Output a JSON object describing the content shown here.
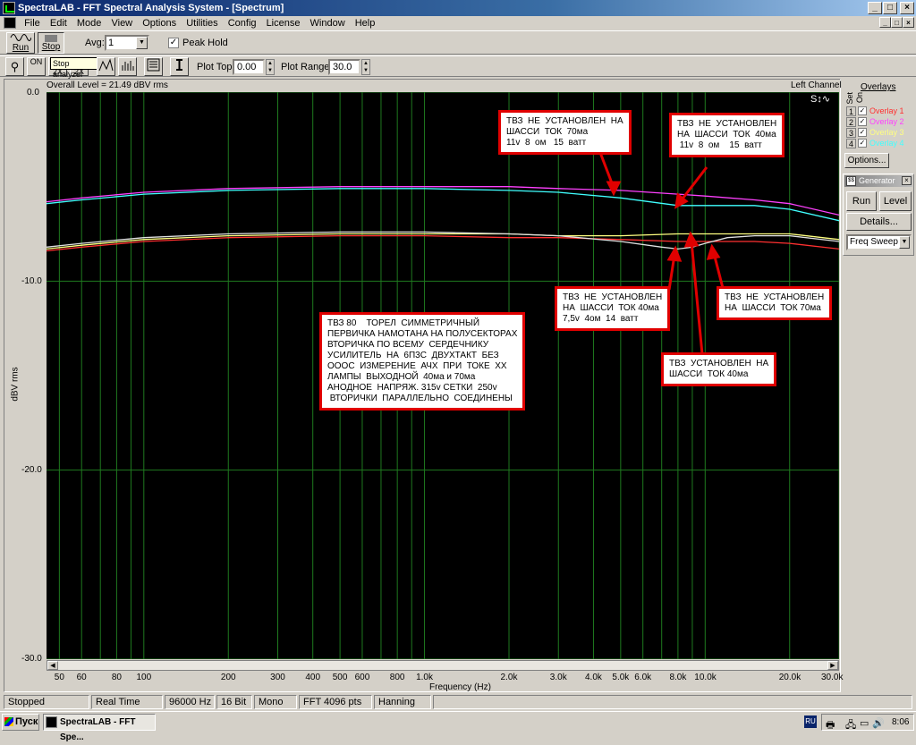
{
  "window": {
    "title": "SpectraLAB - FFT Spectral Analysis System - [Spectrum]"
  },
  "menu": [
    "File",
    "Edit",
    "Mode",
    "View",
    "Options",
    "Utilities",
    "Config",
    "License",
    "Window",
    "Help"
  ],
  "toolbar": {
    "run_label": "Run",
    "stop_label": "Stop",
    "avg_label": "Avg:",
    "avg_value": "1",
    "peak_hold_label": "Peak Hold",
    "peak_hold_checked": true,
    "tooltip": "Stop analyzer",
    "zoom_labels": [
      "ON",
      "2X",
      "2X"
    ],
    "plot_top_label": "Plot Top:",
    "plot_top_value": "0.00",
    "plot_range_label": "Plot Range:",
    "plot_range_value": "30.0"
  },
  "plot": {
    "overall_level": "Overall Level = 21.49 dBV rms",
    "channel": "Left Channel",
    "y_axis_label": "dBV rms",
    "x_axis_label": "Frequency (Hz)",
    "y_ticks": [
      "0.0",
      "-10.0",
      "-20.0",
      "-30.0"
    ],
    "x_ticks": [
      "50",
      "60",
      "80",
      "100",
      "200",
      "300",
      "400",
      "500",
      "600",
      "800",
      "1.0k",
      "2.0k",
      "3.0k",
      "4.0k",
      "5.0k",
      "6.0k",
      "8.0k",
      "10.0k",
      "20.0k",
      "30.0k"
    ]
  },
  "annotations": {
    "a1": "ТВЗ  НЕ  УСТАНОВЛЕН  НА\nШАССИ  ТОК  70ма\n11v  8  ом   15  ватт",
    "a2": "ТВЗ  НЕ  УСТАНОВЛЕН\nНА  ШАССИ  ТОК  40ма\n 11v  8  ом    15  ватт",
    "a3": "ТВЗ  НЕ  УСТАНОВЛЕН\nНА  ШАССИ  ТОК 40ма\n7,5v  4ом  14  ватт",
    "a4": "ТВЗ  НЕ  УСТАНОВЛЕН\nНА  ШАССИ  ТОК 70ма",
    "a5": "ТВЗ  УСТАНОВЛЕН  НА\nШАССИ  ТОК 40ма",
    "a6": "ТВЗ 80    ТОРЕЛ  СИММЕТРИЧНЫЙ\nПЕРВИЧКА НАМОТАНА НА ПОЛУСЕКТОРАХ\nВТОРИЧКА ПО ВСЕМУ  СЕРДЕЧНИКУ\nУСИЛИТЕЛЬ  НА  6П3С  ДВУХТАКТ  БЕЗ\nОООС  ИЗМЕРЕНИЕ  АЧХ  ПРИ  ТОКЕ  ХХ\nЛАМПЫ  ВЫХОДНОЙ  40ма и 70ма\nАНОДНОЕ  НАПРЯЖ. 315v СЕТКИ  250v\n ВТОРИЧКИ  ПАРАЛЛЕЛЬНО  СОЕДИНЕНЫ"
  },
  "overlays": {
    "title": "Overlays",
    "set_label": "Set",
    "on_label": "On",
    "items": [
      {
        "num": "1",
        "name": "Overlay 1",
        "color": "#ff3030"
      },
      {
        "num": "2",
        "name": "Overlay 2",
        "color": "#ff40ff"
      },
      {
        "num": "3",
        "name": "Overlay 3",
        "color": "#ffff80"
      },
      {
        "num": "4",
        "name": "Overlay 4",
        "color": "#40ffff"
      }
    ],
    "options_label": "Options..."
  },
  "generator": {
    "title": "Generator",
    "run_label": "Run",
    "level_label": "Level",
    "details_label": "Details...",
    "mode_value": "Freq Sweep"
  },
  "status": [
    "Stopped",
    "Real Time",
    "96000 Hz",
    "16 Bit",
    "Mono",
    "FFT 4096 pts",
    "Hanning"
  ],
  "taskbar": {
    "start_label": "Пуск",
    "task_label": "SpectraLAB - FFT Spe...",
    "lang": "RU",
    "clock": "8:06"
  },
  "chart_data": {
    "type": "line",
    "xscale": "log",
    "xlim": [
      45,
      30000
    ],
    "ylim": [
      -30,
      0
    ],
    "xlabel": "Frequency (Hz)",
    "ylabel": "dBV rms",
    "series": [
      {
        "color": "#ff40ff",
        "x": [
          45,
          60,
          100,
          200,
          500,
          1000,
          2000,
          3000,
          5000,
          8000,
          10000,
          15000,
          20000,
          30000
        ],
        "y": [
          -5.8,
          -5.6,
          -5.3,
          -5.1,
          -5.0,
          -5.0,
          -5.0,
          -5.1,
          -5.2,
          -5.4,
          -5.5,
          -5.7,
          -5.9,
          -6.5
        ]
      },
      {
        "color": "#40ffff",
        "x": [
          45,
          60,
          100,
          200,
          500,
          1000,
          2000,
          3000,
          5000,
          8000,
          10000,
          15000,
          20000,
          30000
        ],
        "y": [
          -5.9,
          -5.7,
          -5.4,
          -5.2,
          -5.1,
          -5.1,
          -5.2,
          -5.3,
          -5.6,
          -6.0,
          -6.0,
          -6.0,
          -6.2,
          -6.8
        ]
      },
      {
        "color": "#ffff80",
        "x": [
          45,
          60,
          100,
          200,
          500,
          1000,
          2000,
          3000,
          5000,
          8000,
          10000,
          15000,
          20000,
          30000
        ],
        "y": [
          -8.3,
          -8.1,
          -7.8,
          -7.6,
          -7.5,
          -7.5,
          -7.5,
          -7.6,
          -7.6,
          -7.5,
          -7.5,
          -7.5,
          -7.5,
          -7.8
        ]
      },
      {
        "color": "#ff3030",
        "x": [
          45,
          60,
          100,
          200,
          500,
          1000,
          2000,
          3000,
          5000,
          8000,
          10000,
          15000,
          20000,
          30000
        ],
        "y": [
          -8.4,
          -8.2,
          -7.9,
          -7.7,
          -7.6,
          -7.6,
          -7.7,
          -7.7,
          -7.8,
          -7.9,
          -7.9,
          -7.9,
          -8.0,
          -8.3
        ]
      },
      {
        "color": "#e0e0e0",
        "x": [
          45,
          60,
          100,
          200,
          500,
          1000,
          2000,
          3000,
          5000,
          7000,
          8000,
          9000,
          10000,
          12000,
          15000,
          20000,
          30000
        ],
        "y": [
          -8.2,
          -8.0,
          -7.7,
          -7.5,
          -7.4,
          -7.4,
          -7.5,
          -7.6,
          -7.9,
          -8.2,
          -8.3,
          -8.2,
          -8.0,
          -7.7,
          -7.6,
          -7.6,
          -7.9
        ]
      }
    ]
  }
}
